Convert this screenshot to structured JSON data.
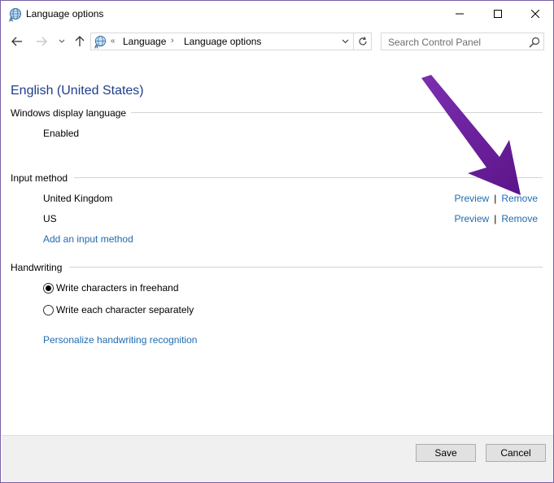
{
  "window": {
    "title": "Language options"
  },
  "navigation": {
    "breadcrumb": [
      "Language",
      "Language options"
    ],
    "overflow": "«",
    "search_placeholder": "Search Control Panel"
  },
  "language": {
    "name": "English (United States)",
    "display_language": {
      "heading": "Windows display language",
      "status": "Enabled"
    },
    "input_method": {
      "heading": "Input method",
      "methods": [
        {
          "name": "United Kingdom",
          "preview": "Preview",
          "remove": "Remove"
        },
        {
          "name": "US",
          "preview": "Preview",
          "remove": "Remove"
        }
      ],
      "add_link": "Add an input method"
    },
    "handwriting": {
      "heading": "Handwriting",
      "options": [
        {
          "label": "Write characters in freehand",
          "selected": true
        },
        {
          "label": "Write each character separately",
          "selected": false
        }
      ],
      "personalize_link": "Personalize handwriting recognition"
    }
  },
  "footer": {
    "save_label": "Save",
    "cancel_label": "Cancel"
  },
  "colors": {
    "link": "#1f6bb0",
    "heading": "#1e3e8a",
    "annotation_arrow": "#6a1b9a"
  },
  "icons": {
    "app": "language-globe-icon",
    "back": "arrow-left-icon",
    "forward": "arrow-right-icon",
    "recent": "chevron-down-icon",
    "up": "arrow-up-icon",
    "refresh": "refresh-icon",
    "search": "search-icon",
    "minimize": "minimize-icon",
    "maximize": "maximize-icon",
    "close": "close-icon"
  }
}
